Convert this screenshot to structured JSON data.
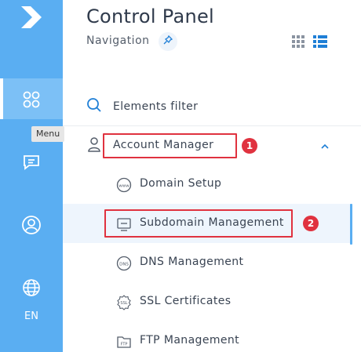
{
  "rail": {
    "items": [
      {
        "name": "brand-logo",
        "icon": "arrow-logo-icon"
      },
      {
        "name": "apps",
        "icon": "four-circles-icon",
        "active": true
      },
      {
        "name": "messages",
        "icon": "chat-icon"
      },
      {
        "name": "profile",
        "icon": "user-circle-icon"
      },
      {
        "name": "language",
        "icon": "globe-icon"
      }
    ],
    "language_label": "EN",
    "tooltip": "Menu"
  },
  "header": {
    "title": "Control Panel",
    "subtitle": "Navigation",
    "pin_icon": "pin-icon",
    "view_options": [
      "grid-view-icon",
      "list-view-icon"
    ]
  },
  "filter": {
    "label": "Elements filter",
    "icon": "search-icon"
  },
  "menu": {
    "section": {
      "label": "Account Manager",
      "icon": "user-icon",
      "expanded": true
    },
    "items": [
      {
        "label": "Domain Setup",
        "icon": "www-icon",
        "selected": false
      },
      {
        "label": "Subdomain Management",
        "icon": "subdomain-icon",
        "selected": true
      },
      {
        "label": "DNS Management",
        "icon": "dns-icon",
        "selected": false
      },
      {
        "label": "SSL Certificates",
        "icon": "ssl-icon",
        "selected": false
      },
      {
        "label": "FTP Management",
        "icon": "ftp-icon",
        "selected": false
      }
    ]
  },
  "annotations": [
    {
      "number": "1",
      "color": "#e0323f"
    },
    {
      "number": "2",
      "color": "#e0323f"
    }
  ],
  "colors": {
    "rail": "#5aaef2",
    "accent": "#1f7fd6",
    "annotation": "#e0323f",
    "selected_row": "#eef5fd"
  }
}
